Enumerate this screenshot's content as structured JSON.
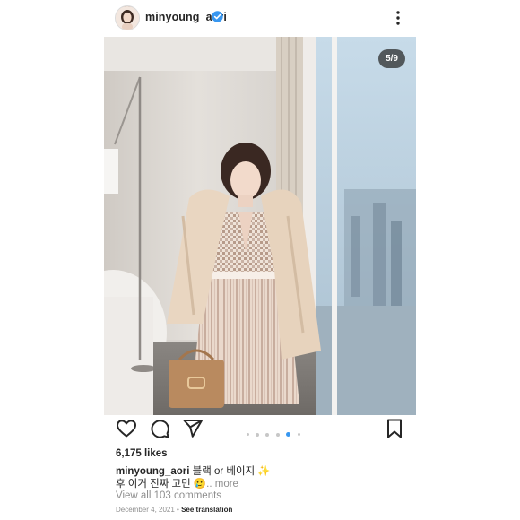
{
  "header": {
    "username": "minyoung_aori",
    "verified": true,
    "more_icon": "more-vertical-icon"
  },
  "photo": {
    "counter": "5/9",
    "description_icon": "photo"
  },
  "actions": {
    "like_icon": "heart-icon",
    "comment_icon": "comment-icon",
    "share_icon": "send-icon",
    "save_icon": "bookmark-icon",
    "carousel_dots": 6,
    "active_dot": 4
  },
  "post": {
    "likes": "6,175 likes",
    "caption_user": "minyoung_aori",
    "caption_line1": " 블랙 or 베이지 ✨",
    "caption_line2": "후 이거 진짜 고민 🥲",
    "caption_more": ".. more",
    "view_comments": "View all 103 comments",
    "date": "December 4, 2021",
    "separator": " • ",
    "see_translation": "See translation"
  },
  "colors": {
    "accent": "#3897f0",
    "text": "#262626",
    "muted": "#8e8e8e"
  }
}
